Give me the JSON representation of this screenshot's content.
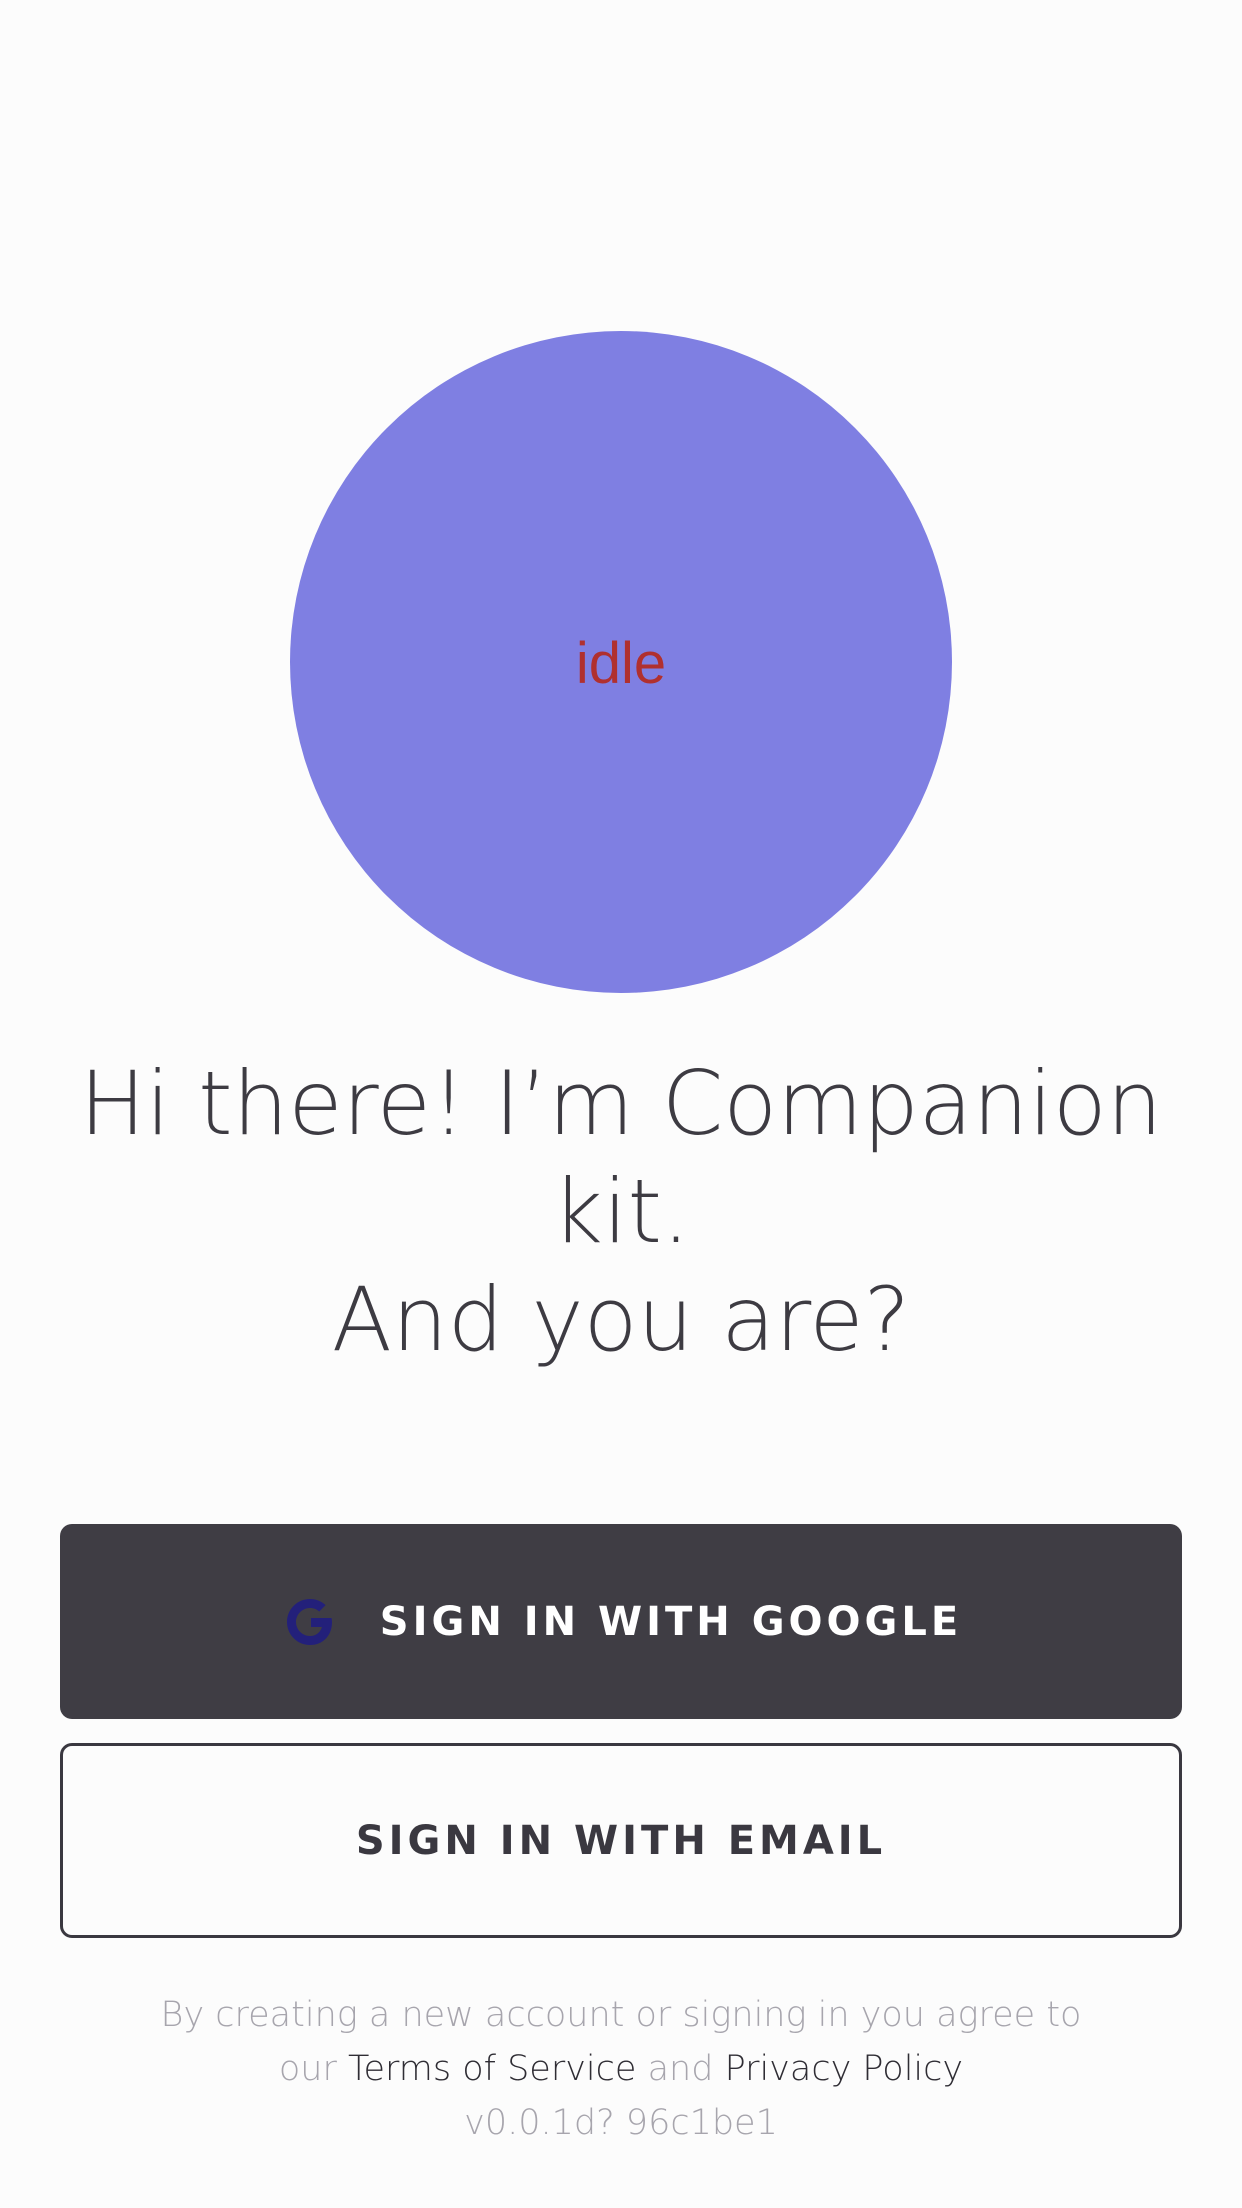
{
  "avatar": {
    "state": "idle",
    "color": "#7f7fe2",
    "state_color": "#b0302f"
  },
  "greeting": {
    "line1": "Hi there! I’m Companion",
    "line2": "kit.",
    "line3": "And you are?"
  },
  "buttons": {
    "google_label": "SIGN IN WITH GOOGLE",
    "google_icon": "google-g-icon",
    "email_label": "SIGN IN WITH EMAIL"
  },
  "legal": {
    "line1": "By creating a new account or signing in you agree to",
    "our": "our",
    "terms": "Terms of Service",
    "and": "and",
    "privacy": "Privacy Policy",
    "version": "v0.0.1d? 96c1be1"
  },
  "colors": {
    "background": "#fcfcfc",
    "primary_button": "#3f3d44",
    "text_dark": "#3d3b42",
    "text_muted": "#a7a5ad",
    "google_icon": "#23207a"
  }
}
